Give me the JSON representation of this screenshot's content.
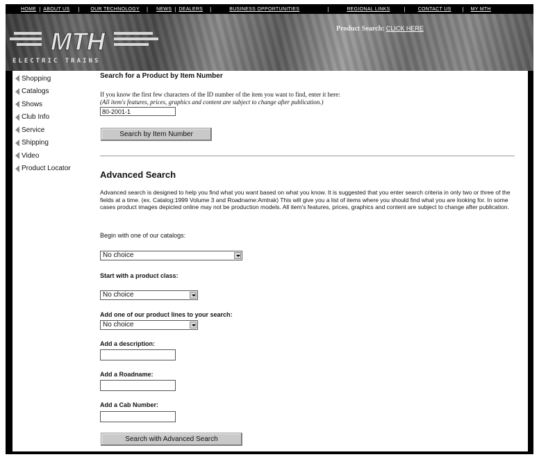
{
  "topnav": {
    "links": [
      "HOME",
      "ABOUT US",
      "OUR TECHNOLOGY",
      "NEWS",
      "DEALERS",
      "BUSINESS OPPORTUNITIES",
      "REGIONAL LINKS",
      "CONTACT US",
      "MY MTH"
    ]
  },
  "banner": {
    "logo_letters": "MTH",
    "logo_subtext": "ELECTRIC TRAINS",
    "product_search_label": "Product Search:",
    "product_search_link": "CLICK HERE"
  },
  "sidebar": {
    "items": [
      "Shopping",
      "Catalogs",
      "Shows",
      "Club Info",
      "Service",
      "Shipping",
      "Video",
      "Product Locator"
    ]
  },
  "item_search": {
    "title": "Search for a Product by Item Number",
    "instruction": "If you know the first few characters of the ID number of the item you want to find, enter it here:",
    "disclaimer": "(All item's features, prices, graphics and content are subject to change after publication.)",
    "input_value": "80-2001-1",
    "button_label": "Search by Item Number"
  },
  "advanced": {
    "title": "Advanced Search",
    "description": "Advanced search is designed to help you find what you want based on what you know. It is suggested that you enter search criteria in only two or three of the fields at a time. (ex. Catalog:1999 Volume 3 and Roadname:Amtrak) This will give you a list of items where you should find what you are looking for. In some cases product images depicted online may not be production models. All item's features, prices, graphics and content are subject to change after publication.",
    "catalog_label": "Begin with one of our catalogs:",
    "catalog_value": "No choice",
    "class_label": "Start with a product class:",
    "class_value": "No choice",
    "lines_label": "Add one of our product lines to your search:",
    "lines_value": "No choice",
    "description_label": "Add a description:",
    "roadname_label": "Add a Roadname:",
    "cab_label": "Add a Cab Number:",
    "button_label": "Search with Advanced Search"
  }
}
